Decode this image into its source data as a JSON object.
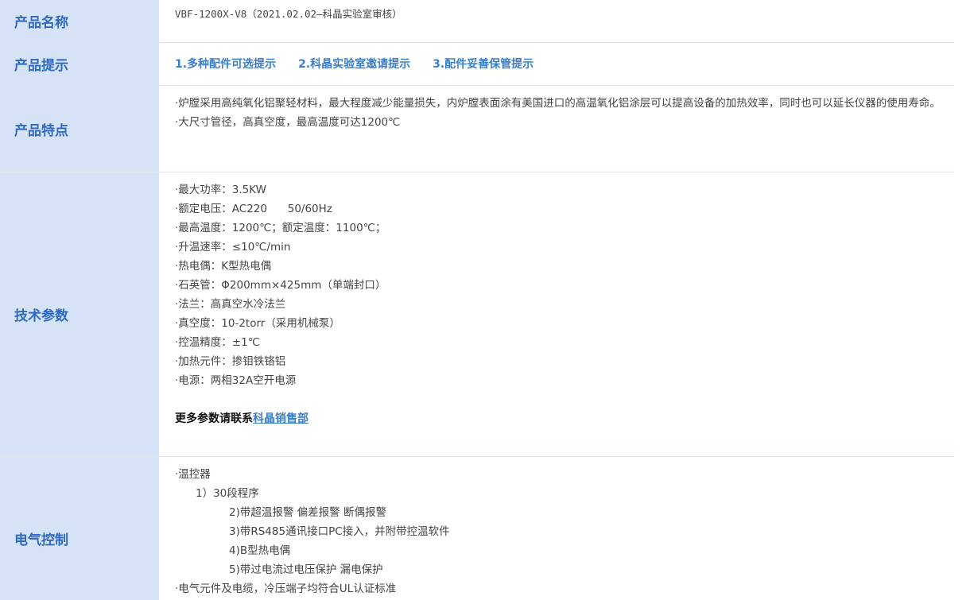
{
  "rows": {
    "name": {
      "label": "产品名称",
      "value": "VBF-1200X-V8（2021.02.02—科晶实验室审核）"
    },
    "tips": {
      "label": "产品提示",
      "items": [
        "1.多种配件可选提示",
        "2.科晶实验室邀请提示",
        "3.配件妥善保管提示"
      ]
    },
    "features": {
      "label": "产品特点",
      "lines": [
        "·炉膛采用高纯氧化铝聚轻材料，最大程度减少能量损失，内炉膛表面涂有美国进口的高温氧化铝涂层可以提高设备的加热效率，同时也可以延长仪器的使用寿命。",
        "·大尺寸管径，高真空度，最高温度可达1200℃"
      ]
    },
    "specs": {
      "label": "技术参数",
      "lines": [
        "·最大功率：3.5KW",
        "·额定电压：AC220      50/60Hz",
        "·最高温度：1200℃；额定温度：1100℃；",
        "·升温速率：≤10℃/min",
        "·热电偶：K型热电偶",
        "·石英管：Φ200mm×425mm（单端封口）",
        "·法兰：高真空水冷法兰",
        "·真空度：10-2torr（采用机械泵）",
        "·控温精度：±1℃",
        "·加热元件：掺钼铁铬铝",
        "·电源：两相32A空开电源"
      ],
      "more_text": "更多参数请联系",
      "more_link": "科晶销售部"
    },
    "electrical": {
      "label": "电气控制",
      "controller": "·温控器",
      "program": "1）30段程序",
      "sub": [
        "2)带超温报警 偏差报警 断偶报警",
        "3)带RS485通讯接口PC接入，并附带控温软件",
        "4)B型热电偶",
        "5)带过电流过电压保护 漏电保护"
      ],
      "cables": "·电气元件及电缆，冷压端子均符合UL认证标准"
    }
  }
}
